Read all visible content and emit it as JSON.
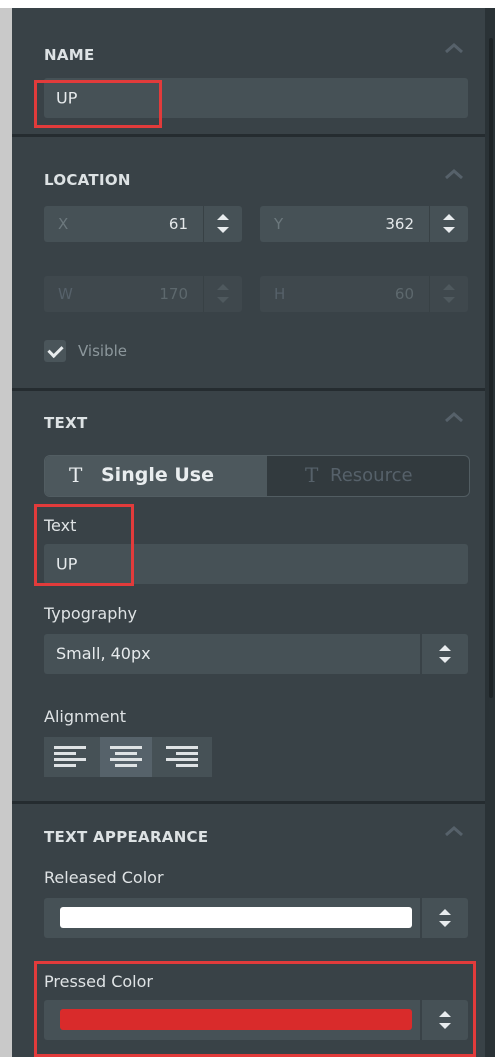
{
  "sections": {
    "name": {
      "title": "NAME",
      "value": "UP"
    },
    "location": {
      "title": "LOCATION",
      "x": {
        "label": "X",
        "value": "61"
      },
      "y": {
        "label": "Y",
        "value": "362"
      },
      "w": {
        "label": "W",
        "value": "170"
      },
      "h": {
        "label": "H",
        "value": "60"
      },
      "visible_label": "Visible",
      "visible_checked": true
    },
    "text": {
      "title": "TEXT",
      "mode_single": "Single Use",
      "mode_resource": "Resource",
      "mode_glyph": "T",
      "text_label": "Text",
      "text_value": "UP",
      "typography_label": "Typography",
      "typography_value": "Small, 40px",
      "alignment_label": "Alignment",
      "alignment_selected": "center"
    },
    "text_appearance": {
      "title": "TEXT APPEARANCE",
      "released_label": "Released Color",
      "released_color": "#ffffff",
      "pressed_label": "Pressed Color",
      "pressed_color": "#d92b2b"
    }
  },
  "colors": {
    "panel_bg": "#394247",
    "field_bg": "#465156",
    "highlight": "#e23b3b"
  }
}
